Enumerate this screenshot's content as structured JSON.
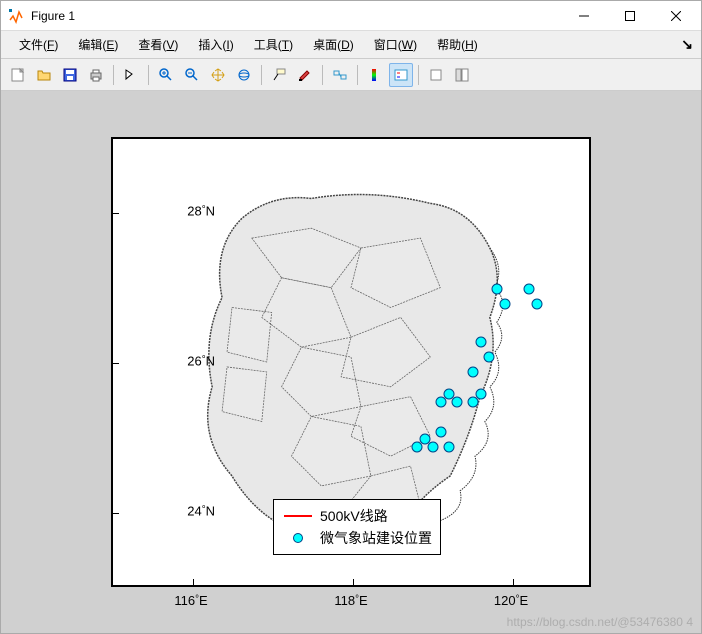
{
  "window": {
    "title": "Figure 1"
  },
  "menu": {
    "items": [
      {
        "label": "文件",
        "accel": "F"
      },
      {
        "label": "编辑",
        "accel": "E"
      },
      {
        "label": "查看",
        "accel": "V"
      },
      {
        "label": "插入",
        "accel": "I"
      },
      {
        "label": "工具",
        "accel": "T"
      },
      {
        "label": "桌面",
        "accel": "D"
      },
      {
        "label": "窗口",
        "accel": "W"
      },
      {
        "label": "帮助",
        "accel": "H"
      }
    ]
  },
  "chart_data": {
    "type": "scatter",
    "title": "",
    "xlabel": "",
    "ylabel": "",
    "xlim": [
      115,
      121
    ],
    "ylim": [
      23,
      29
    ],
    "xticks": [
      116,
      118,
      120
    ],
    "yticks": [
      24,
      26,
      28
    ],
    "xtick_labels": [
      "116°E",
      "118°E",
      "120°E"
    ],
    "ytick_labels": [
      "24°N",
      "26°N",
      "28°N"
    ],
    "series": [
      {
        "name": "500kV线路",
        "type": "line",
        "color": "#ff0000",
        "values": []
      },
      {
        "name": "微气象站建设位置",
        "type": "scatter",
        "color": "#00ffff",
        "x": [
          119.8,
          120.2,
          119.9,
          120.3,
          119.6,
          119.7,
          119.5,
          119.6,
          119.2,
          119.1,
          119.3,
          119.5,
          118.9,
          118.8,
          119.0,
          119.2,
          119.1
        ],
        "y": [
          27.0,
          27.0,
          26.8,
          26.8,
          26.3,
          26.1,
          25.9,
          25.6,
          25.6,
          25.5,
          25.5,
          25.5,
          25.0,
          24.9,
          24.9,
          24.9,
          25.1
        ]
      }
    ],
    "legend": {
      "position": "lower-center",
      "items": [
        {
          "label": "500kV线路",
          "type": "line",
          "color": "#ff0000"
        },
        {
          "label": "微气象站建设位置",
          "type": "marker",
          "color": "#00ffff"
        }
      ]
    }
  },
  "watermark": "https://blog.csdn.net/@53476380 4"
}
